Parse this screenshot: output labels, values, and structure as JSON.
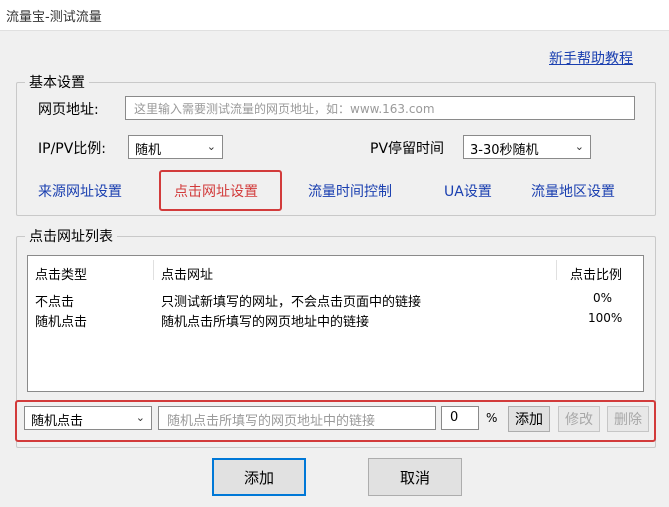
{
  "window": {
    "title": "流量宝-测试流量"
  },
  "help_link": "新手帮助教程",
  "basic_settings": {
    "legend": "基本设置",
    "url_label": "网页地址:",
    "url_placeholder": "这里输入需要测试流量的网页地址，如：www.163.com",
    "ip_pv_label": "IP/PV比例:",
    "ip_pv_value": "随机",
    "pv_stay_label": "PV停留时间",
    "pv_stay_value": "3-30秒随机",
    "links": {
      "source": "来源网址设置",
      "click": "点击网址设置",
      "traffic_time": "流量时间控制",
      "ua": "UA设置",
      "region": "流量地区设置"
    }
  },
  "click_list": {
    "legend": "点击网址列表",
    "columns": [
      "点击类型",
      "点击网址",
      "点击比例"
    ],
    "rows": [
      {
        "type": "不点击",
        "url": "只测试新填写的网址，不会点击页面中的链接",
        "ratio": "0%"
      },
      {
        "type": "随机点击",
        "url": "随机点击所填写的网页地址中的链接",
        "ratio": "100%"
      }
    ]
  },
  "editor": {
    "type_value": "随机点击",
    "url_placeholder": "随机点击所填写的网页地址中的链接",
    "ratio_value": "0",
    "percent": "%",
    "add": "添加",
    "modify": "修改",
    "delete": "删除"
  },
  "footer": {
    "add": "添加",
    "cancel": "取消"
  }
}
